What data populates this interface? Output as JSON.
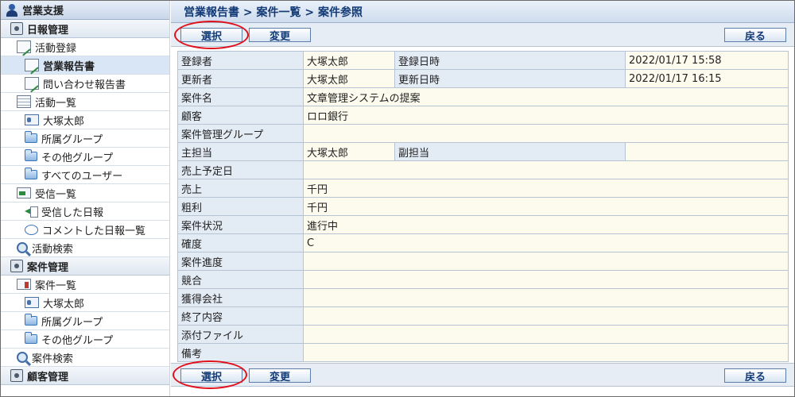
{
  "sidebar": {
    "title": "営業支援",
    "daily": {
      "section": "日報管理",
      "activity_register": "活動登録",
      "sales_report": "営業報告書",
      "inquiry_report": "問い合わせ報告書",
      "activity_list": "活動一覧",
      "user_name": "大塚太郎",
      "my_group": "所属グループ",
      "other_group": "その他グループ",
      "all_users": "すべてのユーザー",
      "received_list": "受信一覧",
      "received_daily": "受信した日報",
      "commented_list": "コメントした日報一覧",
      "activity_search": "活動検索"
    },
    "case": {
      "section": "案件管理",
      "case_list": "案件一覧",
      "user_name": "大塚太郎",
      "my_group": "所属グループ",
      "other_group": "その他グループ",
      "case_search": "案件検索"
    },
    "customer": {
      "section": "顧客管理"
    }
  },
  "breadcrumb": "営業報告書 > 案件一覧 > 案件参照",
  "toolbar": {
    "select_label": "選択",
    "change_label": "変更",
    "back_label": "戻る"
  },
  "detail": {
    "registrant_label": "登録者",
    "registrant": "大塚太郎",
    "registered_at_label": "登録日時",
    "registered_at": "2022/01/17 15:58",
    "updater_label": "更新者",
    "updater": "大塚太郎",
    "updated_at_label": "更新日時",
    "updated_at": "2022/01/17 16:15",
    "case_name_label": "案件名",
    "case_name": "文章管理システムの提案",
    "customer_label": "顧客",
    "customer": "ロロ銀行",
    "case_group_label": "案件管理グループ",
    "case_group": "",
    "main_owner_label": "主担当",
    "main_owner": "大塚太郎",
    "sub_owner_label": "副担当",
    "sub_owner": "",
    "sales_date_label": "売上予定日",
    "sales_date": "",
    "sales_label": "売上",
    "sales": "千円",
    "gross_profit_label": "粗利",
    "gross_profit": "千円",
    "status_label": "案件状況",
    "status": "進行中",
    "certainty_label": "確度",
    "certainty": "C",
    "progress_label": "案件進度",
    "progress": "",
    "competitor_label": "競合",
    "competitor": "",
    "winner_label": "獲得会社",
    "winner": "",
    "closing_label": "終了内容",
    "closing": "",
    "attachment_label": "添付ファイル",
    "attachment": "",
    "notes_label": "備考",
    "notes": ""
  }
}
